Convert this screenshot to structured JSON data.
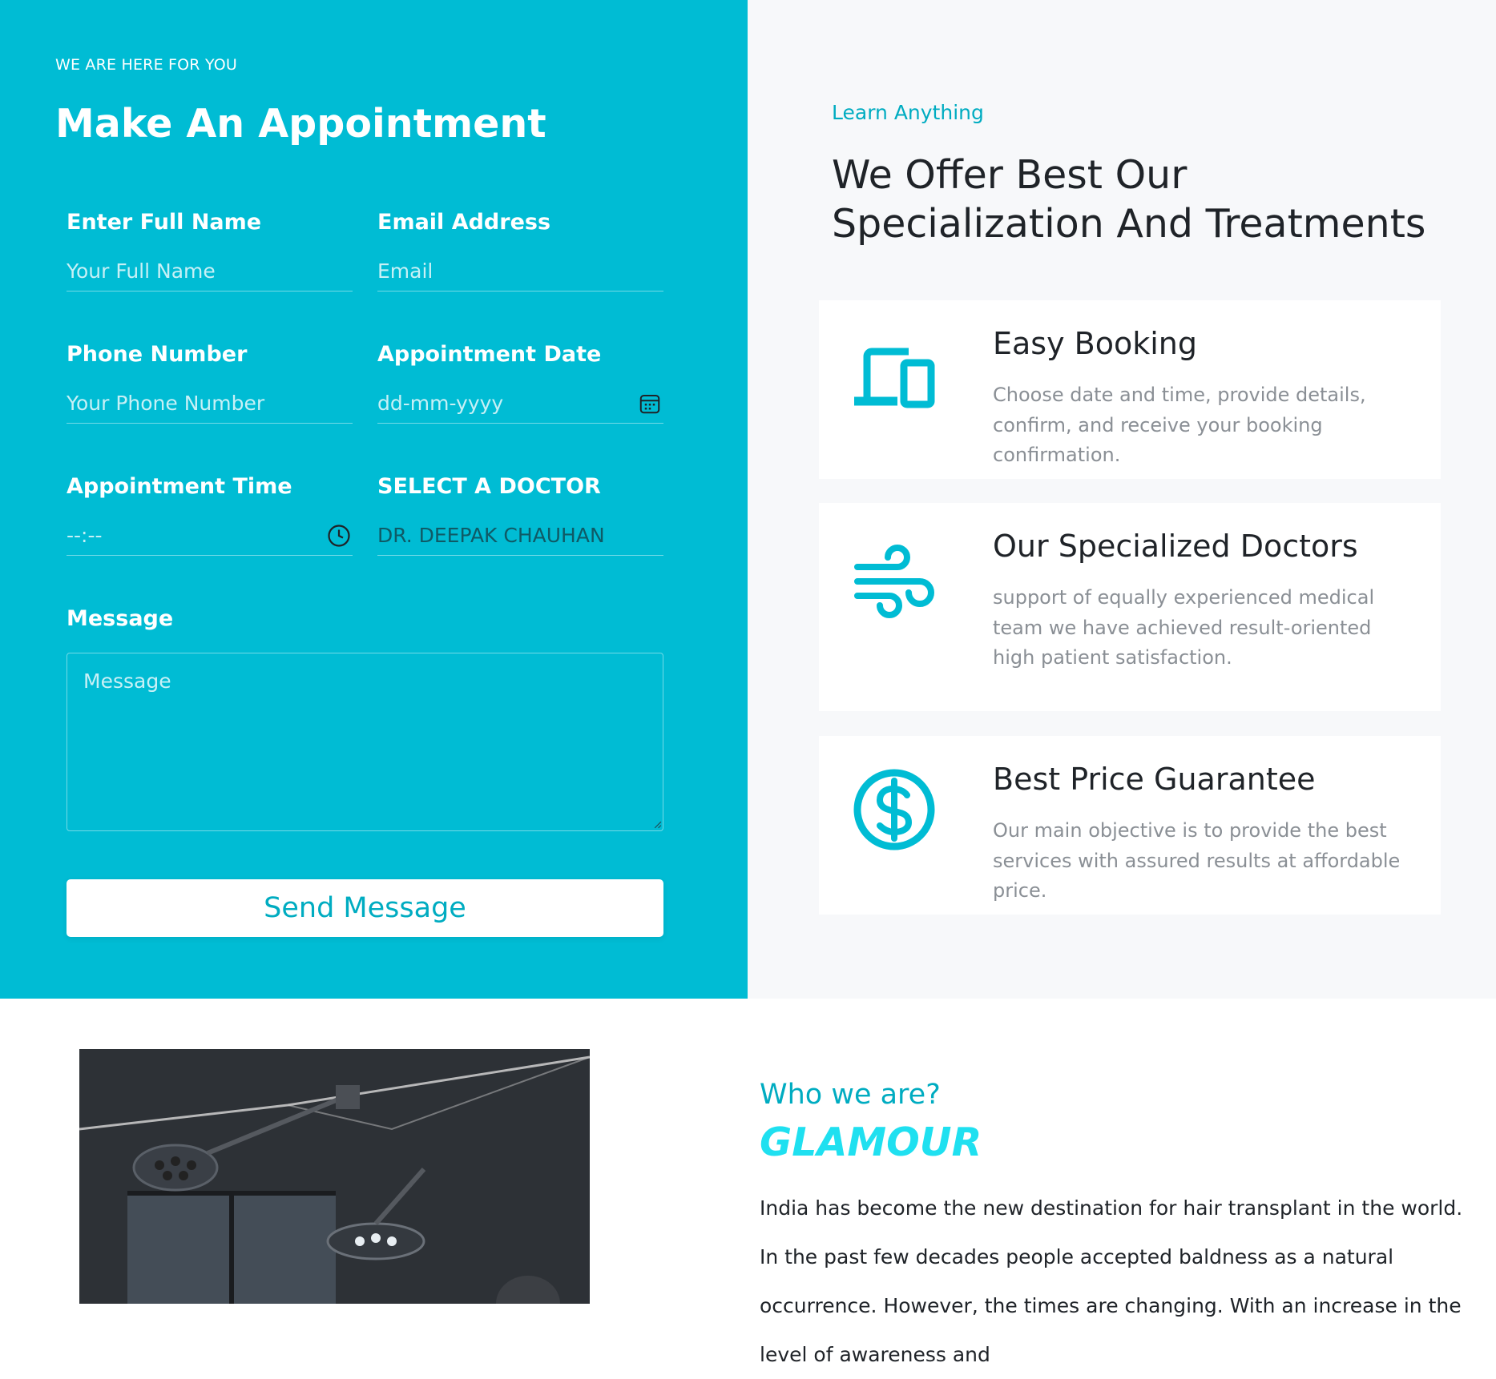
{
  "appointment": {
    "eyebrow": "WE ARE HERE FOR YOU",
    "title": "Make An Appointment",
    "fields": {
      "name": {
        "label": "Enter Full Name",
        "placeholder": "Your Full Name"
      },
      "email": {
        "label": "Email Address",
        "placeholder": "Email"
      },
      "phone": {
        "label": "Phone Number",
        "placeholder": "Your Phone Number"
      },
      "date": {
        "label": "Appointment Date",
        "value": "dd-mm-yyyy",
        "icon": "calendar-icon"
      },
      "time": {
        "label": "Appointment Time",
        "value": "--:--",
        "icon": "clock-icon"
      },
      "doctor": {
        "label": "SELECT A DOCTOR",
        "value": "DR. DEEPAK CHAUHAN"
      }
    },
    "message": {
      "label": "Message",
      "placeholder": "Message"
    },
    "submit_label": "Send Message"
  },
  "specialization": {
    "eyebrow": "Learn Anything",
    "title": "We Offer Best Our Specialization And Treatments",
    "cards": [
      {
        "icon": "devices-icon",
        "title": "Easy Booking",
        "text": "Choose date and time, provide details, confirm, and receive your booking confirmation."
      },
      {
        "icon": "wind-icon",
        "title": "Our Specialized Doctors",
        "text": "support of equally experienced medical team we have achieved result-oriented high patient satisfaction."
      },
      {
        "icon": "dollar-circle-icon",
        "title": "Best Price Guarantee",
        "text": "Our main objective is to provide the best services with assured results at affordable price."
      }
    ]
  },
  "about": {
    "eyebrow": "Who we are?",
    "brand": "GLAMOUR",
    "text": "India has become the new destination for hair transplant in the world. In the past few decades people accepted baldness as a natural occurrence. However, the times are changing. With an increase in the level of awareness and"
  },
  "colors": {
    "accent": "#00bcd4",
    "accent_text": "#00acc1",
    "brand": "#1fe0f0"
  }
}
